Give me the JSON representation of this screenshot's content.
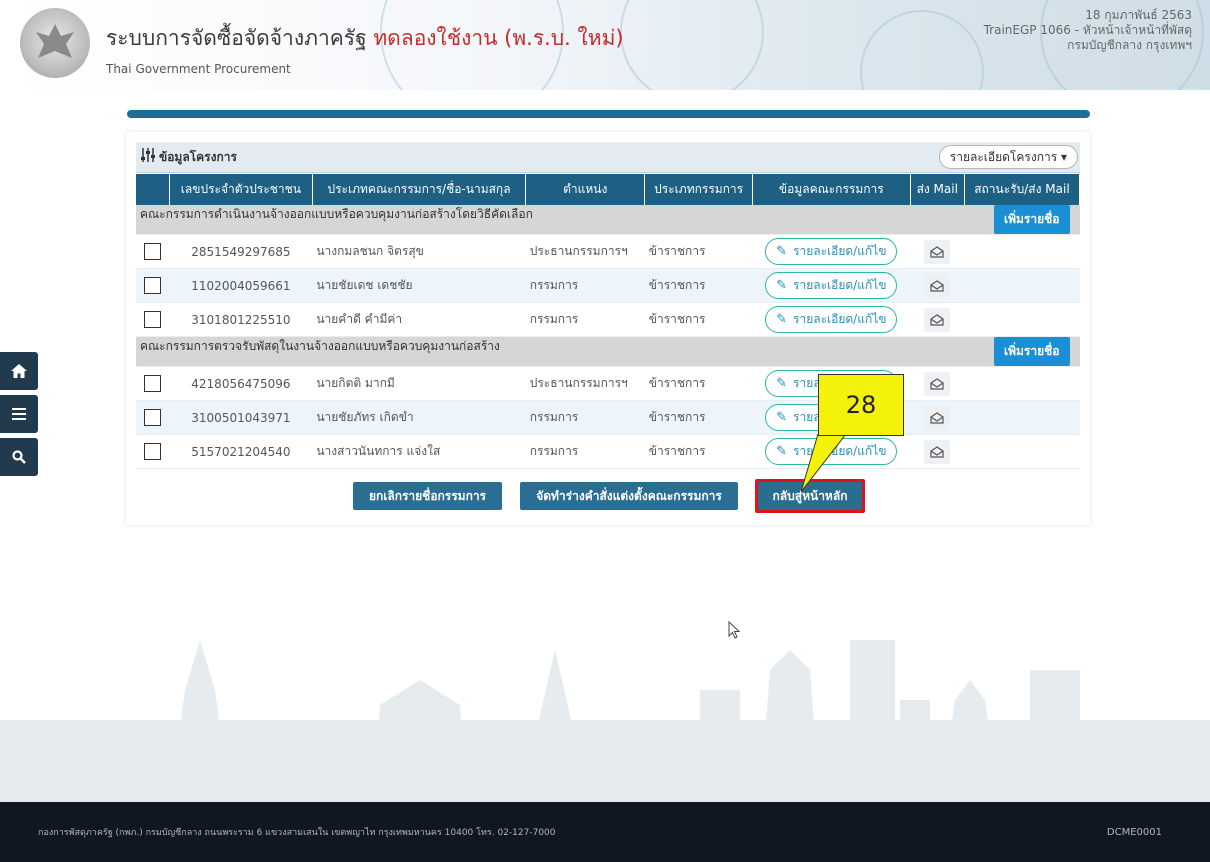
{
  "header": {
    "title_main": "ระบบการจัดซื้อจัดจ้างภาครัฐ",
    "title_trial": "ทดลองใช้งาน (พ.ร.บ. ใหม่)",
    "subtitle": "Thai Government Procurement",
    "date": "18 กุมภาพันธ์ 2563",
    "user": "TrainEGP 1066 - หัวหน้าเจ้าหน้าที่พัสดุ",
    "department": "กรมบัญชีกลาง กรุงเทพฯ"
  },
  "sidenav": {
    "icons": [
      "home-icon",
      "menu-icon",
      "search-icon"
    ]
  },
  "panel": {
    "title": "ข้อมูลโครงการ",
    "detail_button": "รายละเอียดโครงการ ▾"
  },
  "table": {
    "columns": [
      "เลขประจำตัวประชาชน",
      "ประเภทคณะกรรมการ/ชื่อ-นามสกุล",
      "ตำแหน่ง",
      "ประเภทกรรมการ",
      "ข้อมูลคณะกรรมการ",
      "ส่ง Mail",
      "สถานะรับ/ส่ง Mail"
    ],
    "groups": [
      {
        "name": "คณะกรรมการดำเนินงานจ้างออกแบบหรือควบคุมงานก่อสร้างโดยวิธีคัดเลือก",
        "add_label": "เพิ่มรายชื่อ",
        "rows": [
          {
            "id": "2851549297685",
            "name": "นางกมลชนก จิตรสุข",
            "position": "ประธานกรรมการฯ",
            "type": "ข้าราชการ",
            "edit": "รายละเอียด/แก้ไข"
          },
          {
            "id": "1102004059661",
            "name": "นายชัยเดช เดชชัย",
            "position": "กรรมการ",
            "type": "ข้าราชการ",
            "edit": "รายละเอียด/แก้ไข"
          },
          {
            "id": "3101801225510",
            "name": "นายคำดี คำมีค่า",
            "position": "กรรมการ",
            "type": "ข้าราชการ",
            "edit": "รายละเอียด/แก้ไข"
          }
        ]
      },
      {
        "name": "คณะกรรมการตรวจรับพัสดุในงานจ้างออกแบบหรือควบคุมงานก่อสร้าง",
        "add_label": "เพิ่มรายชื่อ",
        "rows": [
          {
            "id": "4218056475096",
            "name": "นายกิตติ มากมี",
            "position": "ประธานกรรมการฯ",
            "type": "ข้าราชการ",
            "edit": "รายละเอียด/แก้ไข"
          },
          {
            "id": "3100501043971",
            "name": "นายชัยภัทร เกิดขำ",
            "position": "กรรมการ",
            "type": "ข้าราชการ",
            "edit": "รายละเอียด/แก้ไข"
          },
          {
            "id": "5157021204540",
            "name": "นางสาวนันทการ แจ่งใส",
            "position": "กรรมการ",
            "type": "ข้าราชการ",
            "edit": "รายละเอียด/แก้ไข"
          }
        ]
      }
    ]
  },
  "actions": {
    "cancel": "ยกเลิกรายชื่อกรรมการ",
    "draft": "จัดทำร่างคำสั่งแต่งตั้งคณะกรรมการ",
    "home": "กลับสู่หน้าหลัก"
  },
  "callout": {
    "number": "28"
  },
  "footer": {
    "text": "กองการพัสดุภาครัฐ (กพภ.) กรมบัญชีกลาง ถนนพระราม 6 แขวงสามเสนใน เขตพญาไท กรุงเทพมหานคร 10400 โทร. 02-127-7000",
    "code": "DCME0001"
  },
  "colors": {
    "header_bar": "#1a6f95",
    "table_header": "#1e5f84",
    "add_button": "#1b8fd6",
    "highlight": "#e1141a",
    "callout": "#f4f20a"
  }
}
